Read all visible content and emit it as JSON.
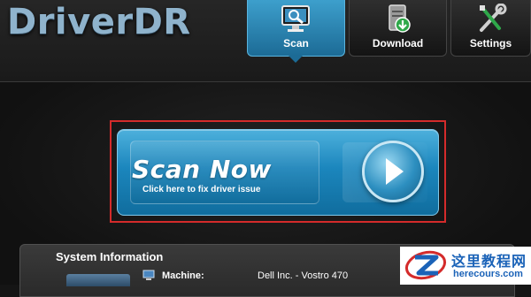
{
  "app": {
    "logo_text": "DriverDR"
  },
  "tabs": [
    {
      "label": "Scan",
      "icon": "monitor-search-icon",
      "active": true
    },
    {
      "label": "Download",
      "icon": "server-download-icon",
      "active": false
    },
    {
      "label": "Settings",
      "icon": "wrench-screwdriver-icon",
      "active": false
    }
  ],
  "scan_button": {
    "title": "Scan Now",
    "subtitle": "Click here to fix driver issue",
    "icon": "arrow-right-circle-icon"
  },
  "system_info": {
    "title": "System Information",
    "machine_label": "Machine:",
    "machine_value": "Dell Inc. - Vostro 470"
  },
  "watermark": {
    "title": "这里教程网",
    "url": "herecours.com"
  },
  "colors": {
    "accent": "#1b86bd",
    "highlight": "#d42b2b",
    "logo": "#8fb3cc",
    "background": "#151515"
  }
}
